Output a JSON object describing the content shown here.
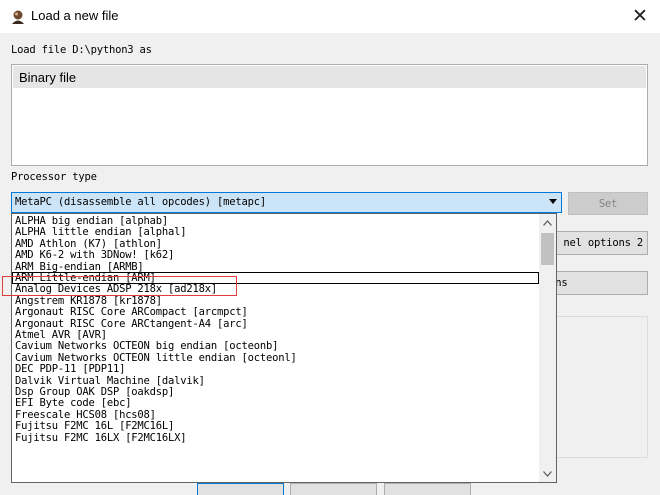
{
  "window": {
    "title": "Load a new file",
    "close_glyph": "✕",
    "icon": "ida-app-icon"
  },
  "load": {
    "label": "Load file D:\\python3 as",
    "items": [
      "Binary file"
    ]
  },
  "processor": {
    "label": "Processor type",
    "selected": "MetaPC (disassemble all opcodes) [metapc]",
    "set_label": "Set",
    "options": [
      "ALPHA big endian [alphab]",
      "ALPHA little endian [alphal]",
      "AMD Athlon (K7) [athlon]",
      "AMD K6-2 with 3DNow! [k62]",
      "ARM Big-endian [ARMB]",
      "ARM Little-endian [ARM]",
      "Analog Devices ADSP 218x [ad218x]",
      "Angstrem KR1878 [kr1878]",
      "Argonaut RISC Core ARCompact [arcmpct]",
      "Argonaut RISC Core ARCtangent-A4 [arc]",
      "Atmel AVR [AVR]",
      "Cavium Networks OCTEON big endian [octeonb]",
      "Cavium Networks OCTEON little endian [octeonl]",
      "DEC PDP-11 [PDP11]",
      "Dalvik Virtual Machine [dalvik]",
      "Dsp Group OAK DSP [oakdsp]",
      "EFI Byte code [ebc]",
      "Freescale HCS08 [hcs08]",
      "Fujitsu F2MC 16L [F2MC16L]",
      "Fujitsu F2MC 16LX [F2MC16LX]"
    ],
    "focused_index": 5
  },
  "side_buttons": {
    "kernel_options": "nel options 2",
    "options": "ions"
  },
  "colors": {
    "combo_fill": "#cce4f7",
    "focus_border": "#0078d7",
    "annotation_red": "#e03c3c"
  }
}
